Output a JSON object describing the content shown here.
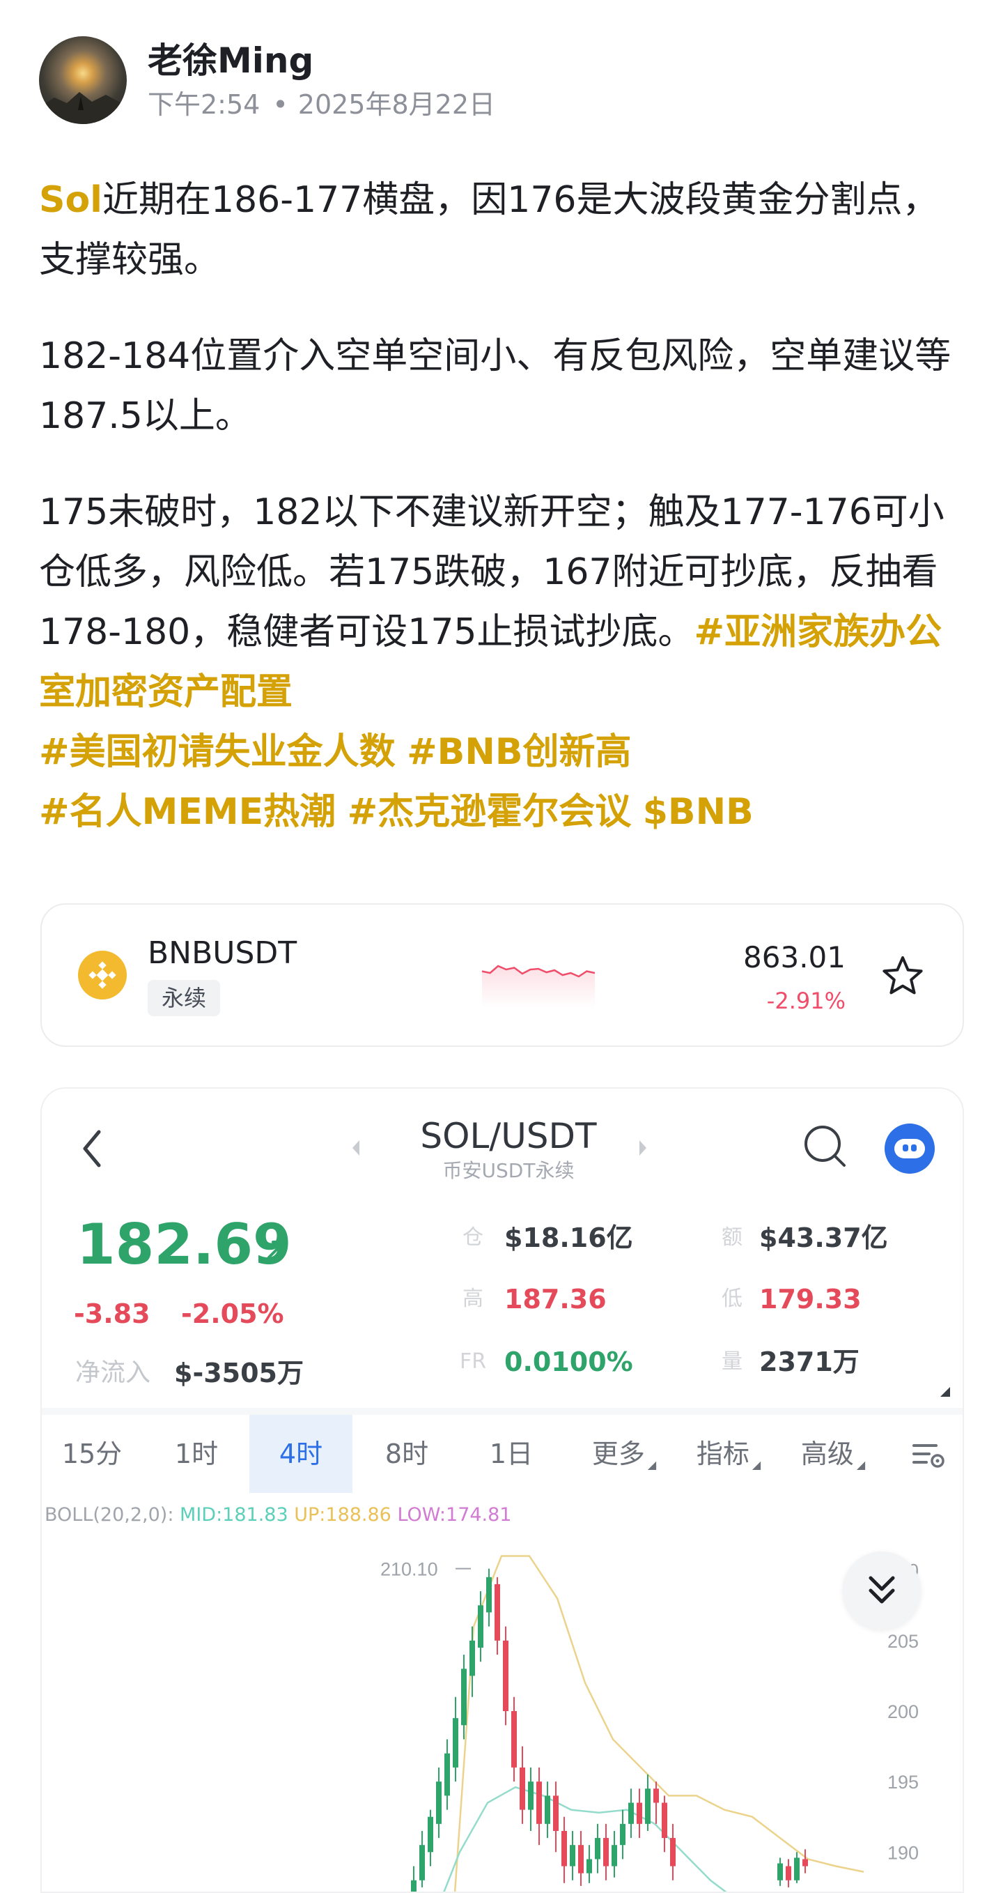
{
  "author": {
    "name": "老徐Ming",
    "time": "下午2:54",
    "date": "2025年8月22日"
  },
  "post": {
    "symbol": "Sol",
    "para1_rest": "近期在186-177横盘，因176是大波段黄金分割点，支撑较强。",
    "para2": "182-184位置介入空单空间小、有反包风险，空单建议等187.5以上。",
    "para3": "175未破时，182以下不建议新开空；触及177-176可小仓低多，风险低。若175跌破，167附近可抄底，反抽看178-180，稳健者可设175止损试抄底。",
    "tags": [
      "#亚洲家族办公室加密资产配置",
      "#美国初请失业金人数",
      "#BNB创新高",
      "#名人MEME热潮",
      "#杰克逊霍尔会议",
      "$BNB"
    ]
  },
  "ticker": {
    "pair": "BNBUSDT",
    "type": "永续",
    "price": "863.01",
    "change": "-2.91%",
    "sparkline": [
      0.55,
      0.6,
      0.4,
      0.5,
      0.45,
      0.62,
      0.5,
      0.48,
      0.58,
      0.52,
      0.66,
      0.6,
      0.7,
      0.55,
      0.6
    ],
    "colors": {
      "down": "#f04d6a",
      "brand": "#f3ba2f"
    }
  },
  "screenshot": {
    "title": "SOL/USDT",
    "subtitle": "币安USDT永续",
    "last_price": "182.69",
    "change_abs": "-3.83",
    "change_pct": "-2.05%",
    "net_inflow_label": "净流入",
    "net_inflow": "$-3505万",
    "open_interest_label": "仓",
    "open_interest": "$18.16亿",
    "volume_amount_label": "额",
    "volume_amount": "$43.37亿",
    "high_label": "高",
    "high": "187.36",
    "low_label": "低",
    "low": "179.33",
    "funding_label": "FR",
    "funding": "0.0100%",
    "qty_label": "量",
    "qty": "2371万",
    "tabs": [
      "15分",
      "1时",
      "4时",
      "8时",
      "1日",
      "更多",
      "指标",
      "高级"
    ],
    "active_tab": "4时",
    "boll": {
      "label": "BOLL(20,2,0):",
      "mid": "MID:181.83",
      "up": "UP:188.86",
      "low": "LOW:174.81"
    },
    "colors": {
      "up": "#2ea36a",
      "down": "#e54a5b",
      "accent": "#2c6fe6"
    }
  },
  "chart_data": {
    "type": "candlestick",
    "y_ticks": [
      "210",
      "205",
      "200",
      "195",
      "190"
    ],
    "marker_label": "210.10",
    "ylim": [
      187,
      213
    ]
  }
}
